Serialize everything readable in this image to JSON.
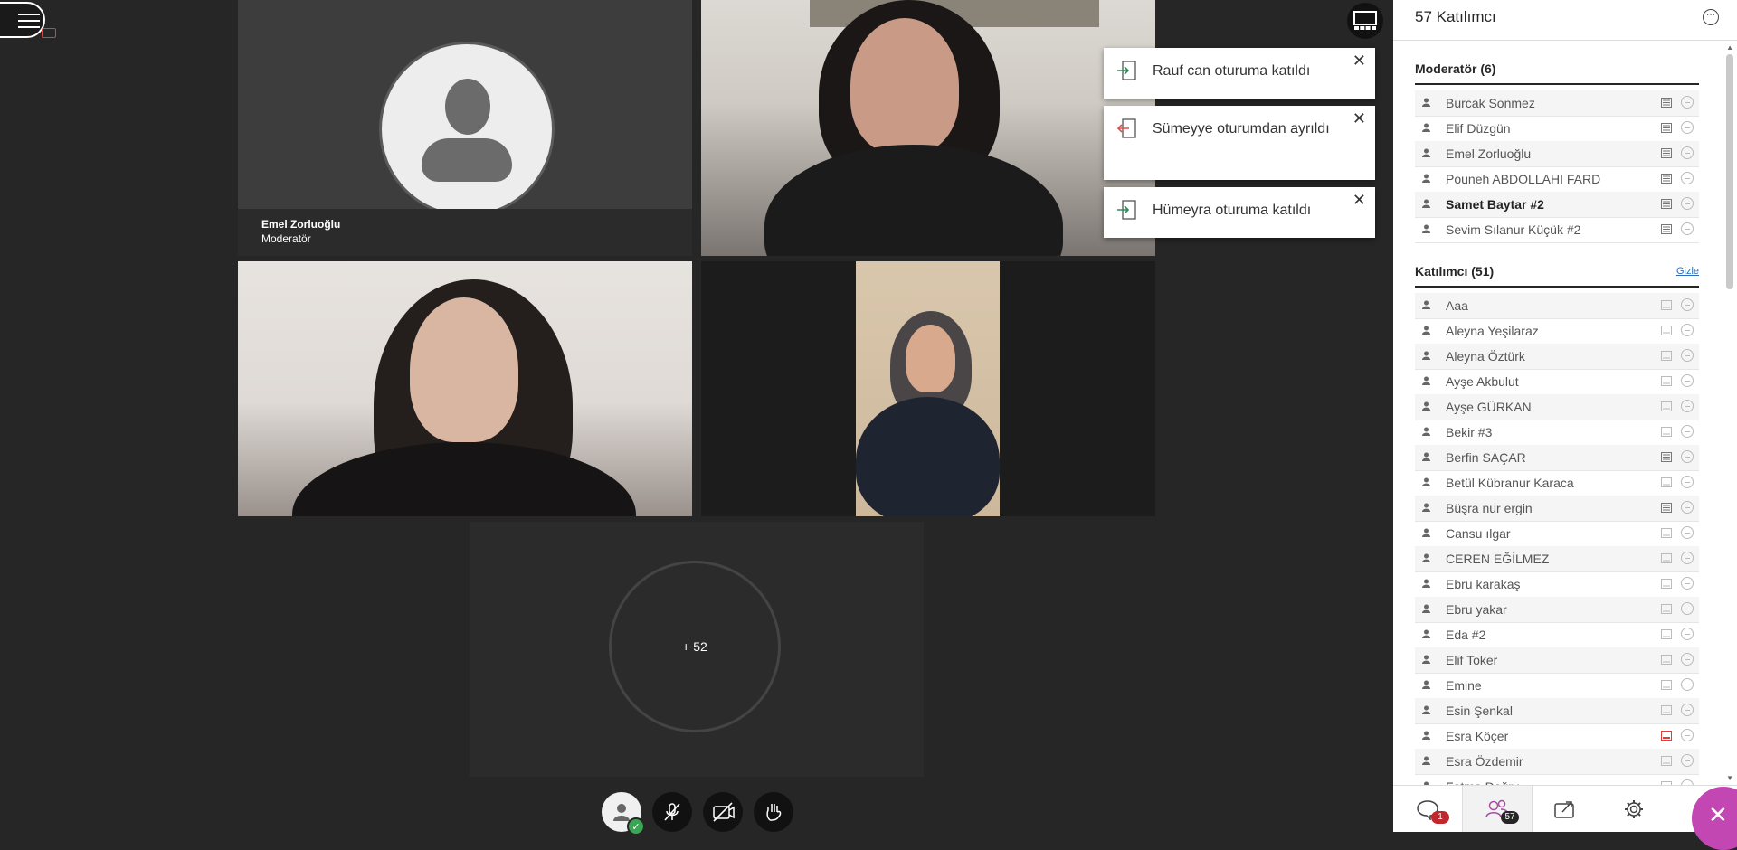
{
  "session": {
    "overflow_count": "+ 52"
  },
  "tiles": {
    "speaker_name": "Emel Zorluoğlu",
    "speaker_role": "Moderatör"
  },
  "toasts": [
    {
      "kind": "join",
      "text": "Rauf can oturuma katıldı"
    },
    {
      "kind": "leave",
      "text": "Sümeyye oturumdan ayrıldı"
    },
    {
      "kind": "join",
      "text": "Hümeyra oturuma katıldı"
    }
  ],
  "panel": {
    "title": "57 Katılımcı",
    "more_icon": "ellipsis-icon",
    "moderators_header": "Moderatör (6)",
    "moderators": [
      {
        "name": "Burcak Sonmez",
        "bold": false,
        "mic": "on"
      },
      {
        "name": "Elif Düzgün",
        "bold": false,
        "mic": "on"
      },
      {
        "name": "Emel Zorluoğlu",
        "bold": false,
        "mic": "on"
      },
      {
        "name": "Pouneh ABDOLLAHI FARD",
        "bold": false,
        "mic": "on"
      },
      {
        "name": "Samet Baytar #2",
        "bold": true,
        "mic": "on"
      },
      {
        "name": "Sevim Sılanur Küçük #2",
        "bold": false,
        "mic": "on"
      }
    ],
    "participants_header": "Katılımcı (51)",
    "participants_hide": "Gizle",
    "participants": [
      {
        "name": "Aaa",
        "mic": "off"
      },
      {
        "name": "Aleyna Yeşilaraz",
        "mic": "off"
      },
      {
        "name": "Aleyna Öztürk",
        "mic": "off"
      },
      {
        "name": "Ayşe Akbulut",
        "mic": "off"
      },
      {
        "name": "Ayşe GÜRKAN",
        "mic": "off"
      },
      {
        "name": "Bekir #3",
        "mic": "off"
      },
      {
        "name": "Berfin SAÇAR",
        "mic": "on"
      },
      {
        "name": "Betül Kübranur Karaca",
        "mic": "off"
      },
      {
        "name": "Büşra nur ergin",
        "mic": "on"
      },
      {
        "name": "Cansu ılgar",
        "mic": "off"
      },
      {
        "name": "CEREN EĞİLMEZ",
        "mic": "off"
      },
      {
        "name": "Ebru karakaş",
        "mic": "off"
      },
      {
        "name": "Ebru yakar",
        "mic": "off"
      },
      {
        "name": "Eda #2",
        "mic": "off"
      },
      {
        "name": "Elif Toker",
        "mic": "off"
      },
      {
        "name": "Emine",
        "mic": "off"
      },
      {
        "name": "Esin Şenkal",
        "mic": "off"
      },
      {
        "name": "Esra Köçer",
        "mic": "active"
      },
      {
        "name": "Esra Özdemir",
        "mic": "off"
      },
      {
        "name": "Fatma Doğru",
        "mic": "off"
      }
    ]
  },
  "nav": {
    "chat_badge": "1",
    "participants_badge": "57"
  },
  "colors": {
    "stage_bg": "#262626",
    "accent_close": "#c247b3",
    "badge_red": "#c0282d",
    "talking_red": "#e03c3c",
    "join_green": "#2e8b57",
    "leave_red": "#d9534f"
  }
}
